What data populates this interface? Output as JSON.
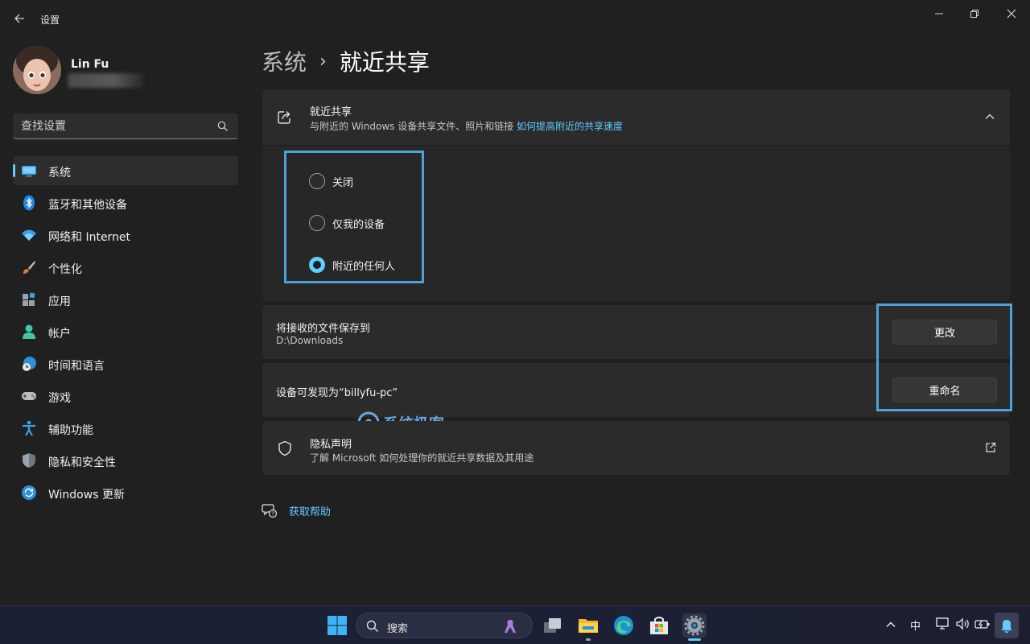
{
  "window": {
    "title": "设置"
  },
  "profile": {
    "name": "Lin Fu"
  },
  "search": {
    "placeholder": "查找设置"
  },
  "nav": {
    "items": [
      {
        "label": "系统",
        "icon": "system-icon",
        "active": true
      },
      {
        "label": "蓝牙和其他设备",
        "icon": "bluetooth-icon"
      },
      {
        "label": "网络和 Internet",
        "icon": "wifi-icon"
      },
      {
        "label": "个性化",
        "icon": "brush-icon"
      },
      {
        "label": "应用",
        "icon": "apps-icon"
      },
      {
        "label": "帐户",
        "icon": "account-icon"
      },
      {
        "label": "时间和语言",
        "icon": "time-language-icon"
      },
      {
        "label": "游戏",
        "icon": "gamepad-icon"
      },
      {
        "label": "辅助功能",
        "icon": "accessibility-icon"
      },
      {
        "label": "隐私和安全性",
        "icon": "shield-icon"
      },
      {
        "label": "Windows 更新",
        "icon": "update-icon"
      }
    ]
  },
  "breadcrumb": {
    "parent": "系统",
    "separator": "›",
    "current": "就近共享"
  },
  "nearby": {
    "title": "就近共享",
    "subtitle": "与附近的 Windows 设备共享文件、照片和链接",
    "link": "如何提高附近的共享速度",
    "options": [
      {
        "label": "关闭",
        "checked": false
      },
      {
        "label": "仅我的设备",
        "checked": false
      },
      {
        "label": "附近的任何人",
        "checked": true
      }
    ]
  },
  "save_location": {
    "title": "将接收的文件保存到",
    "path": "D:\\Downloads",
    "button": "更改"
  },
  "discoverable": {
    "title": "设备可发现为“billyfu-pc”",
    "button": "重命名"
  },
  "watermark": {
    "text": "系统极客"
  },
  "privacy": {
    "title": "隐私声明",
    "subtitle": "了解 Microsoft 如何处理你的就近共享数据及其用途"
  },
  "help": {
    "label": "获取帮助"
  },
  "taskbar": {
    "search_label": "搜索",
    "ime": "中"
  },
  "colors": {
    "accent": "#60cdff",
    "highlight_box": "#4ba3d9",
    "background": "#202020",
    "card": "#2b2b2b"
  }
}
